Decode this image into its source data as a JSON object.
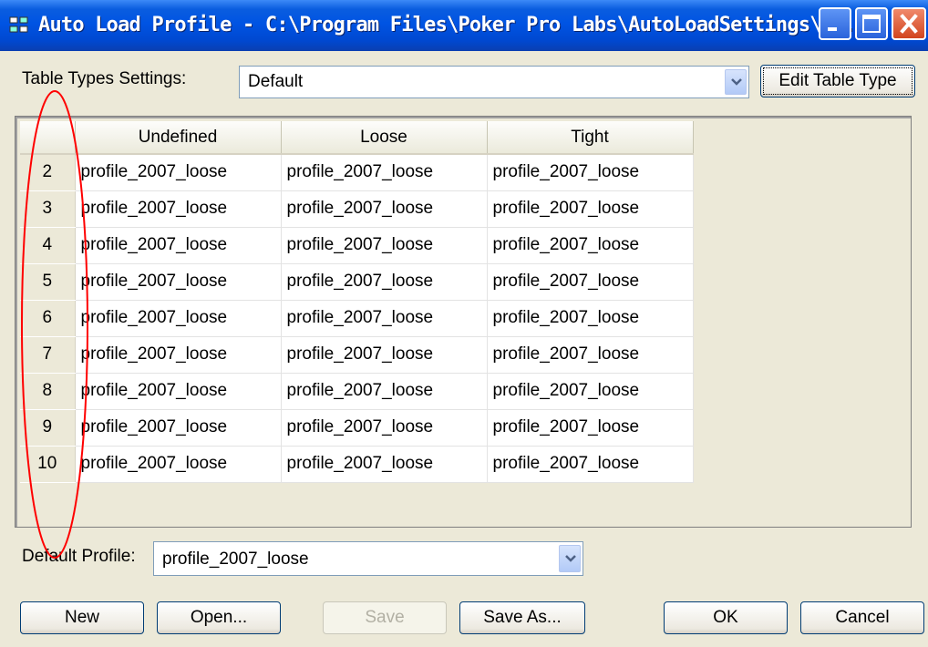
{
  "window": {
    "title": "Auto Load Profile - C:\\Program Files\\Poker Pro Labs\\AutoLoadSettings\\..."
  },
  "table_types": {
    "label": "Table Types Settings:",
    "selected": "Default",
    "edit_button": "Edit Table Type"
  },
  "grid": {
    "columns": [
      "Undefined",
      "Loose",
      "Tight"
    ],
    "rows": [
      {
        "num": "2",
        "cells": [
          "profile_2007_loose",
          "profile_2007_loose",
          "profile_2007_loose"
        ]
      },
      {
        "num": "3",
        "cells": [
          "profile_2007_loose",
          "profile_2007_loose",
          "profile_2007_loose"
        ]
      },
      {
        "num": "4",
        "cells": [
          "profile_2007_loose",
          "profile_2007_loose",
          "profile_2007_loose"
        ]
      },
      {
        "num": "5",
        "cells": [
          "profile_2007_loose",
          "profile_2007_loose",
          "profile_2007_loose"
        ]
      },
      {
        "num": "6",
        "cells": [
          "profile_2007_loose",
          "profile_2007_loose",
          "profile_2007_loose"
        ]
      },
      {
        "num": "7",
        "cells": [
          "profile_2007_loose",
          "profile_2007_loose",
          "profile_2007_loose"
        ]
      },
      {
        "num": "8",
        "cells": [
          "profile_2007_loose",
          "profile_2007_loose",
          "profile_2007_loose"
        ]
      },
      {
        "num": "9",
        "cells": [
          "profile_2007_loose",
          "profile_2007_loose",
          "profile_2007_loose"
        ]
      },
      {
        "num": "10",
        "cells": [
          "profile_2007_loose",
          "profile_2007_loose",
          "profile_2007_loose"
        ]
      }
    ]
  },
  "default_profile": {
    "label": "Default Profile:",
    "selected": "profile_2007_loose"
  },
  "buttons": {
    "new": "New",
    "open": "Open...",
    "save": "Save",
    "save_as": "Save As...",
    "ok": "OK",
    "cancel": "Cancel"
  },
  "colors": {
    "annotation": "#ff0000",
    "title_bar": "#0054e3",
    "dialog_bg": "#ece9d8"
  }
}
